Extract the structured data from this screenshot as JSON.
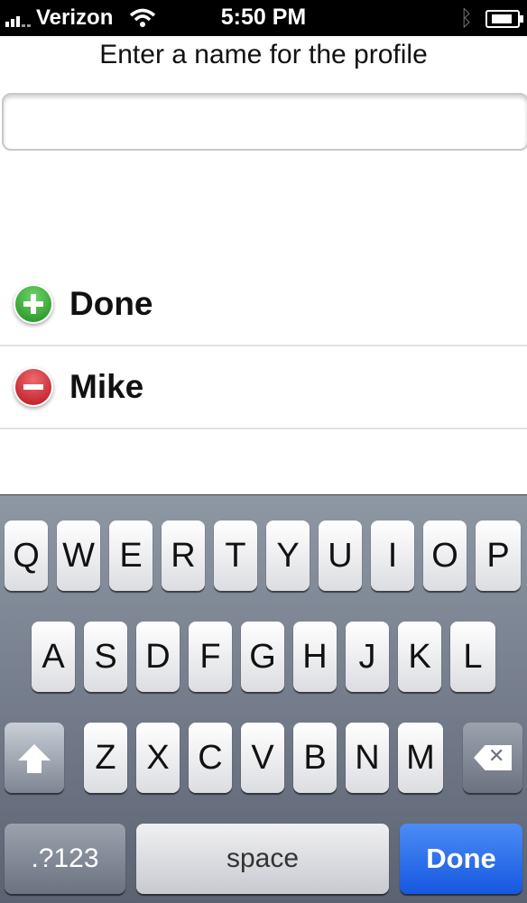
{
  "status_bar": {
    "carrier": "Verizon",
    "time": "5:50 PM",
    "icons": [
      "signal-icon",
      "wifi-icon",
      "bluetooth-icon",
      "battery-icon"
    ]
  },
  "prompt": "Enter a name for the profile",
  "name_field": {
    "value": "",
    "placeholder": ""
  },
  "rows": [
    {
      "label": "Done",
      "icon": "add-icon"
    },
    {
      "label": "Mike",
      "icon": "delete-icon"
    }
  ],
  "keyboard": {
    "row1": [
      "Q",
      "W",
      "E",
      "R",
      "T",
      "Y",
      "U",
      "I",
      "O",
      "P"
    ],
    "row2": [
      "A",
      "S",
      "D",
      "F",
      "G",
      "H",
      "J",
      "K",
      "L"
    ],
    "row3": [
      "Z",
      "X",
      "C",
      "V",
      "B",
      "N",
      "M"
    ],
    "mode_key": ".?123",
    "space": "space",
    "done": "Done"
  },
  "colors": {
    "done_key": "#1558e0",
    "add_icon": "#1e8d1c",
    "delete_icon": "#b8121c"
  }
}
